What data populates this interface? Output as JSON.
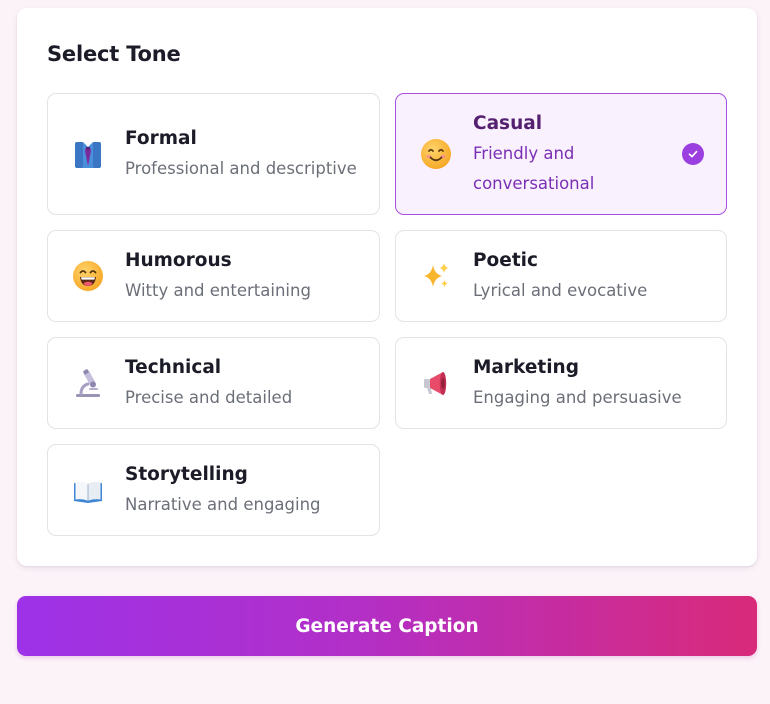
{
  "panel": {
    "title": "Select Tone"
  },
  "tones": [
    {
      "name": "Formal",
      "desc": "Professional and descriptive",
      "icon": "necktie-icon",
      "selected": false
    },
    {
      "name": "Casual",
      "desc": "Friendly and conversational",
      "desc_line1": "Friendly and",
      "desc_line2": "conversational",
      "icon": "smiling-face-icon",
      "selected": true
    },
    {
      "name": "Humorous",
      "desc": "Witty and entertaining",
      "icon": "grinning-face-icon",
      "selected": false
    },
    {
      "name": "Poetic",
      "desc": "Lyrical and evocative",
      "icon": "sparkles-icon",
      "selected": false
    },
    {
      "name": "Technical",
      "desc": "Precise and detailed",
      "icon": "microscope-icon",
      "selected": false
    },
    {
      "name": "Marketing",
      "desc": "Engaging and persuasive",
      "icon": "megaphone-icon",
      "selected": false
    },
    {
      "name": "Storytelling",
      "desc": "Narrative and engaging",
      "icon": "open-book-icon",
      "selected": false
    }
  ],
  "colors": {
    "accent": "#9b3fe0",
    "selected_bg": "#f9f1fd",
    "button_gradient_start": "#9d32e8",
    "button_gradient_end": "#d92a7a"
  },
  "actions": {
    "generate_label": "Generate Caption"
  }
}
